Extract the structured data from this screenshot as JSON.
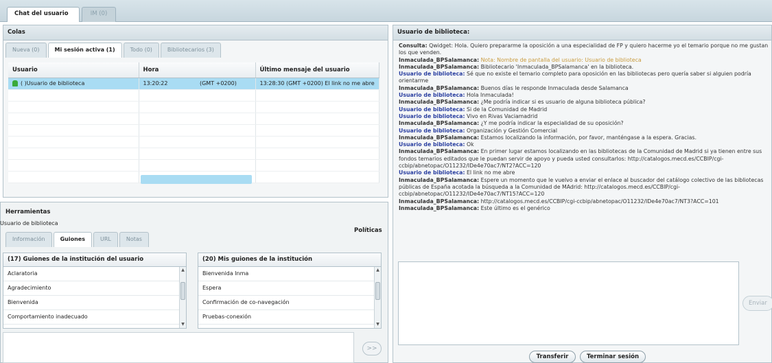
{
  "top_tabs": {
    "chat": "Chat del usuario",
    "im": "IM (0)"
  },
  "colas": {
    "title": "Colas",
    "tabs": [
      "Nueva (0)",
      "Mi sesión activa (1)",
      "Todo (0)",
      "Bibliotecarios (3)"
    ],
    "columns": [
      "Usuario",
      "Hora",
      "Último mensaje del usuario"
    ],
    "row": {
      "user": "( )Usuario de biblioteca",
      "hora": "13:20:22",
      "tz": "(GMT +0200)",
      "ultimo": "13:28:30 (GMT +0200) El link no me abre"
    }
  },
  "herramientas": {
    "title": "Herramientas",
    "user": "Usuario de biblioteca",
    "politicas": "Políticas",
    "tabs": [
      "Información",
      "Guiones",
      "URL",
      "Notas"
    ],
    "list_left": {
      "header": "(17) Guiones de la institución del usuario",
      "items": [
        "Aclaratoria",
        "Agradecimiento",
        "Bienvenida",
        "Comportamiento inadecuado"
      ]
    },
    "list_right": {
      "header": "(20) Mis guiones de la institución",
      "items": [
        "Bienvenida Inma",
        "Espera",
        "Confirmación de co-navegación",
        "Pruebas-conexión"
      ]
    },
    "forward_label": ">>"
  },
  "chat": {
    "title": "Usuario de biblioteca:",
    "messages": [
      {
        "who": "Consulta:",
        "style": "k",
        "text": " Qwidget: Hola. Quiero prepararme la oposición a una especialidad de FP y quiero hacerme yo el temario porque no me gustan los que venden."
      },
      {
        "who": "Inmaculada_BPSalamanca:",
        "style": "k",
        "text": " Nota: Nombre de pantalla del usuario: Usuario de biblioteca",
        "note": true
      },
      {
        "who": "Inmaculada_BPSalamanca:",
        "style": "k",
        "text": " Bibliotecario 'Inmaculada_BPSalamanca' en la biblioteca."
      },
      {
        "who": "Usuario de biblioteca:",
        "style": "u",
        "text": " Sé que no existe el temario completo para oposición en las bibliotecas pero quería saber si alguien podría orientarme"
      },
      {
        "who": "Inmaculada_BPSalamanca:",
        "style": "k",
        "text": " Buenos días le responde Inmaculada desde Salamanca"
      },
      {
        "who": "Usuario de biblioteca:",
        "style": "u",
        "text": " Hola Inmaculada!"
      },
      {
        "who": "Inmaculada_BPSalamanca:",
        "style": "k",
        "text": " ¿Me podría indicar si es usuario de alguna biblioteca pública?"
      },
      {
        "who": "Usuario de biblioteca:",
        "style": "u",
        "text": " Si de la Comunidad de Madrid"
      },
      {
        "who": "Usuario de biblioteca:",
        "style": "u",
        "text": " Vivo en Rivas Vaciamadrid"
      },
      {
        "who": "Inmaculada_BPSalamanca:",
        "style": "k",
        "text": " ¿Y me podría indicar la especialidad de su oposición?"
      },
      {
        "who": "Usuario de biblioteca:",
        "style": "u",
        "text": " Organización y Gestión Comercial"
      },
      {
        "who": "Inmaculada_BPSalamanca:",
        "style": "k",
        "text": " Estamos localizando la información, por favor, manténgase a la espera. Gracias."
      },
      {
        "who": "Usuario de biblioteca:",
        "style": "u",
        "text": " Ok"
      },
      {
        "who": "Inmaculada_BPSalamanca:",
        "style": "k",
        "text": " En primer lugar estamos localizando en las bibliotecas de la Comunidad de Madrid si ya tienen  entre sus fondos  temarios editados  que le puedan servir de apoyo y pueda usted consultarlos: http://catalogos.mecd.es/CCBIP/cgi-ccbip/abnetopac/O11232/IDe4e70ac7/NT2?ACC=120"
      },
      {
        "who": "Usuario de biblioteca:",
        "style": "u",
        "text": " El link no me abre"
      },
      {
        "who": "Inmaculada_BPSalamanca:",
        "style": "k",
        "text": " Espere un momento que le vuelvo a enviar el enlace al buscador del catálogo colectivo de las bibliotecas públicas de España acotada la búsqueda a la Comunidad de MAdrid: http://catalogos.mecd.es/CCBIP/cgi-ccbip/abnetopac/O11232/IDe4e70ac7/NT15?ACC=120"
      },
      {
        "who": "Inmaculada_BPSalamanca:",
        "style": "k",
        "text": " http://catalogos.mecd.es/CCBIP/cgi-ccbip/abnetopac/O11232/IDe4e70ac7/NT3?ACC=101"
      },
      {
        "who": "Inmaculada_BPSalamanca:",
        "style": "k",
        "text": " Este último es el genérico"
      }
    ],
    "send_label": "Enviar",
    "transfer_label": "Transferir",
    "end_label": "Terminar sesión"
  },
  "colors": {
    "selected_row": "#a9dcf3",
    "user_name": "#2a3fa0",
    "note": "#c89a3c"
  }
}
